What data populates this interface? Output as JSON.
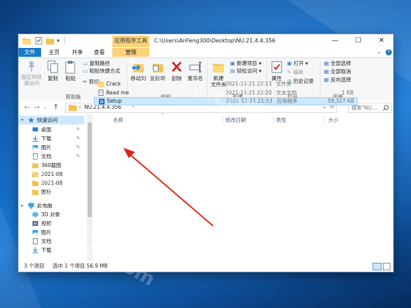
{
  "window": {
    "title_path": "C:\\Users\\AnFeng300\\Desktop\\NU.21.4.4.356",
    "context_tab": "应用程序工具",
    "minimize": "—",
    "maximize": "☐",
    "close": "✕"
  },
  "tabs": {
    "file": "文件",
    "home": "主页",
    "share": "共享",
    "view": "查看",
    "manage": "管理"
  },
  "ribbon": {
    "pin_quick": "固定到快速访问",
    "copy": "复制",
    "paste": "粘贴",
    "copy_path": "复制路径",
    "paste_shortcut": "粘贴快捷方式",
    "cut": "剪切",
    "group_clipboard": "剪贴板",
    "move_to": "移动到",
    "copy_to": "复制到",
    "delete": "删除",
    "rename": "重命名",
    "group_organize": "组织",
    "new_folder": "新建\n文件夹",
    "new_item": "新建项目 ▾",
    "easy_access": "轻松访问 ▾",
    "group_new": "新建",
    "properties": "属性",
    "open": "打开 ▾",
    "edit": "编辑",
    "history": "历史记录",
    "group_open": "打开",
    "select_all": "全部选择",
    "select_none": "全部取消",
    "invert": "反向选择",
    "group_select": "选择"
  },
  "address": {
    "crumb": "NU.21.4.4.356",
    "search_placeholder": "搜索\"NU....",
    "search_icon": "search-icon"
  },
  "nav": [
    {
      "label": "快速访问",
      "icon": "star-icon",
      "pinned": false
    },
    {
      "label": "桌面",
      "icon": "desktop-icon",
      "pinned": true
    },
    {
      "label": "下载",
      "icon": "download-icon",
      "pinned": true
    },
    {
      "label": "图片",
      "icon": "pictures-icon",
      "pinned": true
    },
    {
      "label": "文档",
      "icon": "documents-icon",
      "pinned": true
    },
    {
      "label": "360截图",
      "icon": "folder-icon",
      "pinned": false
    },
    {
      "label": "2021-08",
      "icon": "folder-icon",
      "pinned": false
    },
    {
      "label": "2021-08",
      "icon": "folder-icon",
      "pinned": false
    },
    {
      "label": "图标",
      "icon": "folder-icon",
      "pinned": false
    },
    {
      "label": "此电脑",
      "icon": "computer-icon",
      "pinned": false
    },
    {
      "label": "3D 对象",
      "icon": "3d-objects-icon",
      "pinned": false
    },
    {
      "label": "视频",
      "icon": "video-icon",
      "pinned": false
    },
    {
      "label": "图片",
      "icon": "pictures-icon",
      "pinned": false
    },
    {
      "label": "文档",
      "icon": "documents-icon",
      "pinned": false
    },
    {
      "label": "下载",
      "icon": "download-icon",
      "pinned": false
    }
  ],
  "columns": {
    "name": "名称",
    "modified": "修改日期",
    "type": "类型",
    "size": "大小"
  },
  "files": [
    {
      "name": "Crack",
      "modified": "2021-11-21 22:13",
      "type": "文件夹",
      "size": "",
      "icon": "folder-icon"
    },
    {
      "name": "Read me",
      "modified": "2021-11-21 22:20",
      "type": "文本文档",
      "size": "1 KB",
      "icon": "text-file-icon"
    },
    {
      "name": "Setup",
      "modified": "2021-11-21 21:53",
      "type": "应用程序",
      "size": "58,327 KB",
      "icon": "installer-icon"
    }
  ],
  "status": {
    "count": "3 个项目",
    "selected": "选中 1 个项目  56.9 MB"
  },
  "watermark": {
    "a": "MacXF.com",
    "b": "MacXF.com",
    "c": "MacXF.com"
  },
  "colors": {
    "accent": "#1979ca",
    "context": "#f9d27a",
    "arrow": "#e0221b",
    "selection": "#cce8ff"
  }
}
